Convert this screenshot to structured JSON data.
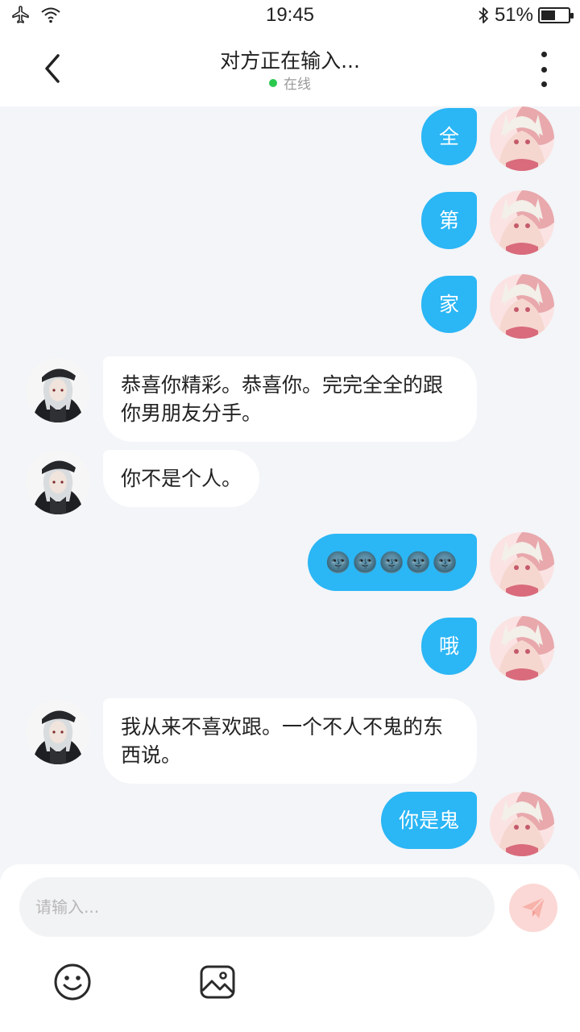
{
  "status_bar": {
    "time": "19:45",
    "battery_text": "51%",
    "battery_level": 0.51,
    "icons": [
      "airplane-icon",
      "wifi-icon",
      "bluetooth-icon",
      "battery-icon"
    ]
  },
  "header": {
    "title": "对方正在输入...",
    "status": "在线",
    "status_color": "#2ac94e"
  },
  "messages": [
    {
      "side": "me",
      "text": "全"
    },
    {
      "side": "me",
      "text": "第"
    },
    {
      "side": "me",
      "text": "家"
    },
    {
      "side": "other",
      "text": "恭喜你精彩。恭喜你。完完全全的跟你男朋友分手。"
    },
    {
      "side": "other",
      "text": "你不是个人。"
    },
    {
      "side": "me",
      "text": "🌚🌚🌚🌚🌚"
    },
    {
      "side": "me",
      "text": "哦"
    },
    {
      "side": "other",
      "text": "我从来不喜欢跟。一个不人不鬼的东西说。"
    },
    {
      "side": "me",
      "text": "你是鬼"
    }
  ],
  "composer": {
    "placeholder": "请输入..."
  },
  "colors": {
    "my_bubble": "#2bb6f5",
    "other_bubble": "#ffffff",
    "background": "#f3f5f8",
    "send_button": "#fbd8d5"
  }
}
